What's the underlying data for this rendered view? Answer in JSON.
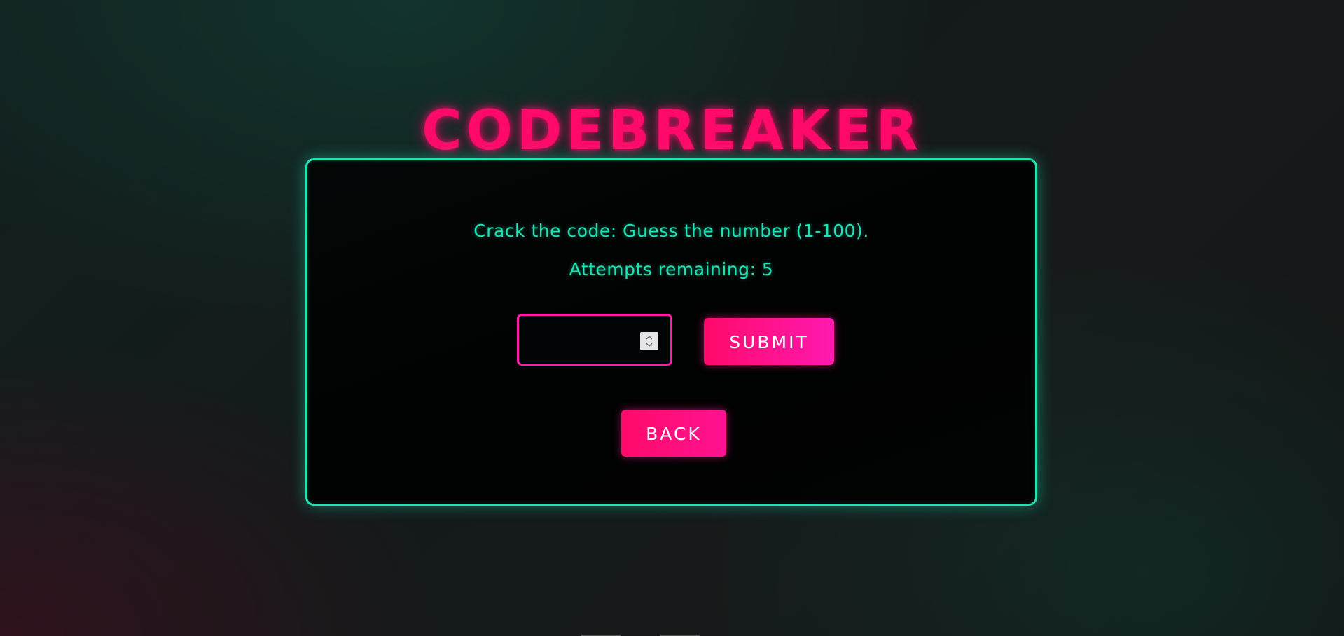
{
  "game": {
    "title": "CODEBREAKER",
    "instruction": "Crack the code: Guess the number (1-100).",
    "attempts_label": "Attempts remaining:",
    "attempts_value": "5"
  },
  "form": {
    "guess_value": "",
    "guess_placeholder": "",
    "submit_label": "SUBMIT",
    "back_label": "BACK"
  },
  "colors": {
    "accent_pink": "#ff0a6a",
    "accent_teal": "#1ee3b4"
  },
  "icons": {
    "spinner_up": "chevron-up-icon",
    "spinner_down": "chevron-down-icon"
  }
}
